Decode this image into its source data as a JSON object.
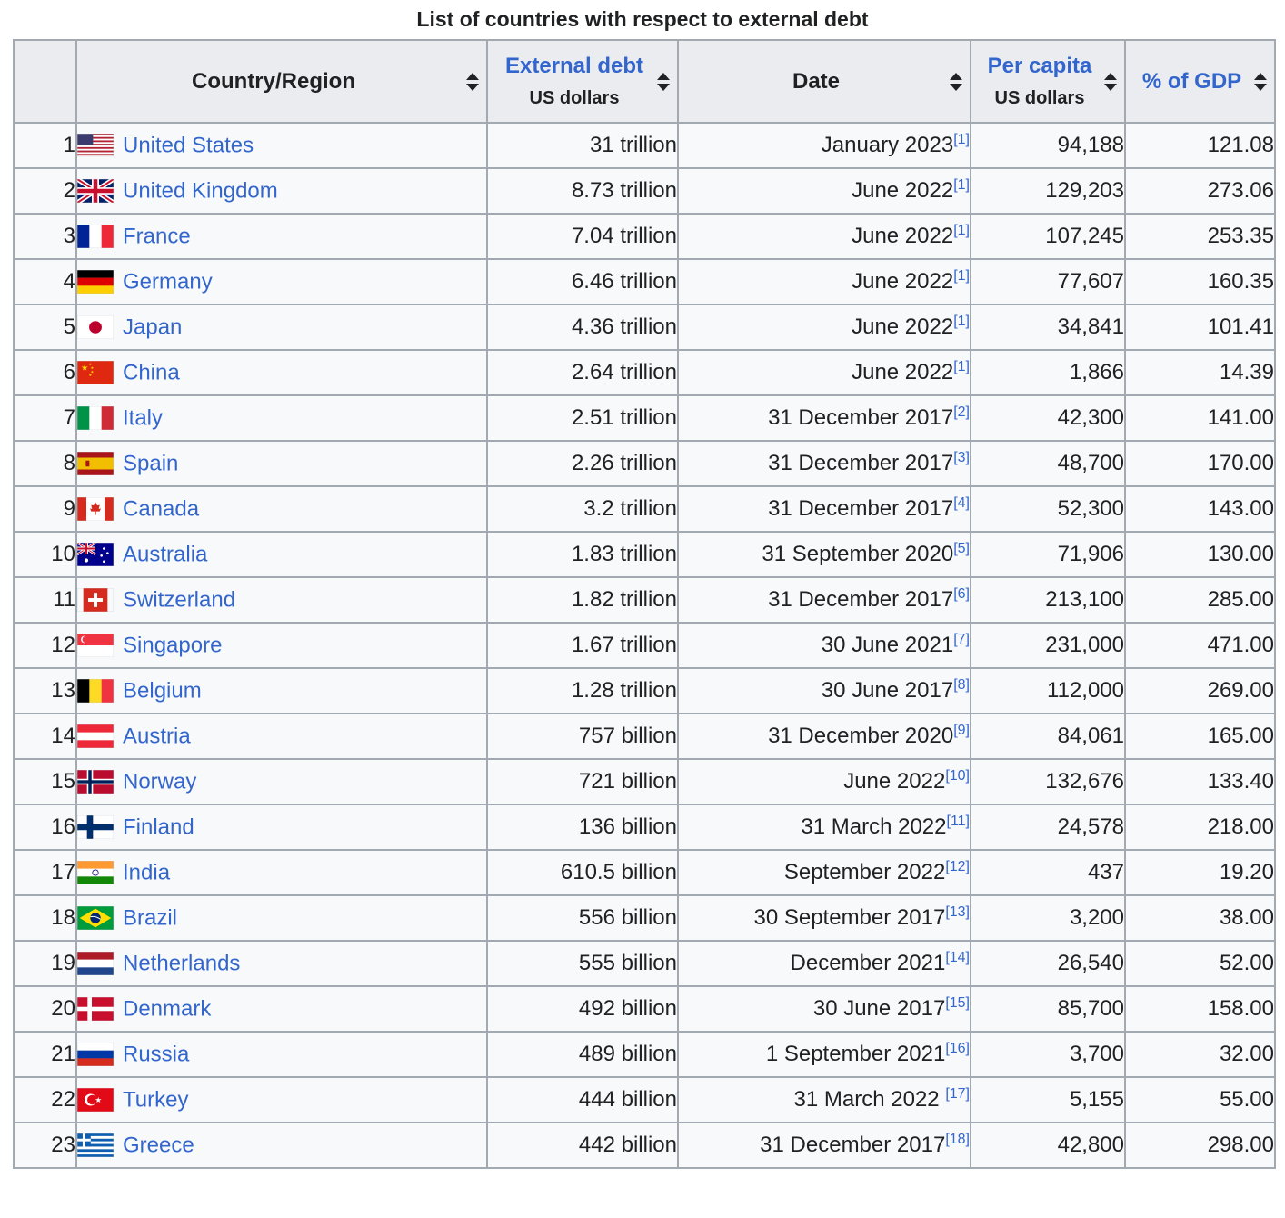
{
  "caption": "List of countries with respect to external debt",
  "headers": {
    "rank": "",
    "country": "Country/Region",
    "debt": "External debt",
    "debt_sub": "US dollars",
    "date": "Date",
    "per_capita": "Per capita",
    "per_capita_sub": "US dollars",
    "gdp": "% of GDP"
  },
  "rows": [
    {
      "rank": "1",
      "country": "United States",
      "flag": "us",
      "debt": "31 trillion",
      "date": "January 2023",
      "ref": "[1]",
      "per_capita": "94,188",
      "gdp": "121.08"
    },
    {
      "rank": "2",
      "country": "United Kingdom",
      "flag": "gb",
      "debt": "8.73 trillion",
      "date": "June 2022",
      "ref": "[1]",
      "per_capita": "129,203",
      "gdp": "273.06"
    },
    {
      "rank": "3",
      "country": "France",
      "flag": "fr",
      "debt": "7.04 trillion",
      "date": "June 2022",
      "ref": "[1]",
      "per_capita": "107,245",
      "gdp": "253.35"
    },
    {
      "rank": "4",
      "country": "Germany",
      "flag": "de",
      "debt": "6.46 trillion",
      "date": "June 2022",
      "ref": "[1]",
      "per_capita": "77,607",
      "gdp": "160.35"
    },
    {
      "rank": "5",
      "country": "Japan",
      "flag": "jp",
      "debt": "4.36 trillion",
      "date": "June 2022",
      "ref": "[1]",
      "per_capita": "34,841",
      "gdp": "101.41"
    },
    {
      "rank": "6",
      "country": "China",
      "flag": "cn",
      "debt": "2.64 trillion",
      "date": "June 2022",
      "ref": "[1]",
      "per_capita": "1,866",
      "gdp": "14.39"
    },
    {
      "rank": "7",
      "country": "Italy",
      "flag": "it",
      "debt": "2.51 trillion",
      "date": "31 December 2017",
      "ref": "[2]",
      "per_capita": "42,300",
      "gdp": "141.00"
    },
    {
      "rank": "8",
      "country": "Spain",
      "flag": "es",
      "debt": "2.26 trillion",
      "date": "31 December 2017",
      "ref": "[3]",
      "per_capita": "48,700",
      "gdp": "170.00"
    },
    {
      "rank": "9",
      "country": "Canada",
      "flag": "ca",
      "debt": "3.2 trillion",
      "date": "31 December 2017",
      "ref": "[4]",
      "per_capita": "52,300",
      "gdp": "143.00"
    },
    {
      "rank": "10",
      "country": "Australia",
      "flag": "au",
      "debt": "1.83 trillion",
      "date": "31 September 2020",
      "ref": "[5]",
      "per_capita": "71,906",
      "gdp": "130.00"
    },
    {
      "rank": "11",
      "country": "Switzerland",
      "flag": "ch",
      "debt": "1.82 trillion",
      "date": "31 December 2017",
      "ref": "[6]",
      "per_capita": "213,100",
      "gdp": "285.00"
    },
    {
      "rank": "12",
      "country": "Singapore",
      "flag": "sg",
      "debt": "1.67 trillion",
      "date": "30 June 2021",
      "ref": "[7]",
      "per_capita": "231,000",
      "gdp": "471.00"
    },
    {
      "rank": "13",
      "country": "Belgium",
      "flag": "be",
      "debt": "1.28 trillion",
      "date": "30 June 2017",
      "ref": "[8]",
      "per_capita": "112,000",
      "gdp": "269.00"
    },
    {
      "rank": "14",
      "country": "Austria",
      "flag": "at",
      "debt": "757 billion",
      "date": "31 December 2020",
      "ref": "[9]",
      "per_capita": "84,061",
      "gdp": "165.00"
    },
    {
      "rank": "15",
      "country": "Norway",
      "flag": "no",
      "debt": "721 billion",
      "date": "June 2022",
      "ref": "[10]",
      "per_capita": "132,676",
      "gdp": "133.40"
    },
    {
      "rank": "16",
      "country": "Finland",
      "flag": "fi",
      "debt": "136 billion",
      "date": "31 March 2022",
      "ref": "[11]",
      "per_capita": "24,578",
      "gdp": "218.00"
    },
    {
      "rank": "17",
      "country": "India",
      "flag": "in",
      "debt": "610.5 billion",
      "date": "September 2022",
      "ref": "[12]",
      "per_capita": "437",
      "gdp": "19.20"
    },
    {
      "rank": "18",
      "country": "Brazil",
      "flag": "br",
      "debt": "556 billion",
      "date": "30 September 2017",
      "ref": "[13]",
      "per_capita": "3,200",
      "gdp": "38.00"
    },
    {
      "rank": "19",
      "country": "Netherlands",
      "flag": "nl",
      "debt": "555 billion",
      "date": "December 2021",
      "ref": "[14]",
      "per_capita": "26,540",
      "gdp": "52.00"
    },
    {
      "rank": "20",
      "country": "Denmark",
      "flag": "dk",
      "debt": "492 billion",
      "date": "30 June 2017",
      "ref": "[15]",
      "per_capita": "85,700",
      "gdp": "158.00"
    },
    {
      "rank": "21",
      "country": "Russia",
      "flag": "ru",
      "debt": "489 billion",
      "date": "1 September 2021",
      "ref": "[16]",
      "per_capita": "3,700",
      "gdp": "32.00"
    },
    {
      "rank": "22",
      "country": "Turkey",
      "flag": "tr",
      "debt": "444 billion",
      "date": "31 March 2022 ",
      "ref": "[17]",
      "per_capita": "5,155",
      "gdp": "55.00"
    },
    {
      "rank": "23",
      "country": "Greece",
      "flag": "gr",
      "debt": "442 billion",
      "date": "31 December 2017",
      "ref": "[18]",
      "per_capita": "42,800",
      "gdp": "298.00"
    }
  ],
  "colors": {
    "link": "#3366cc",
    "header_bg": "#eaecf0",
    "cell_bg": "#f8f9fa",
    "border": "#a2a9b1",
    "text": "#202122"
  }
}
